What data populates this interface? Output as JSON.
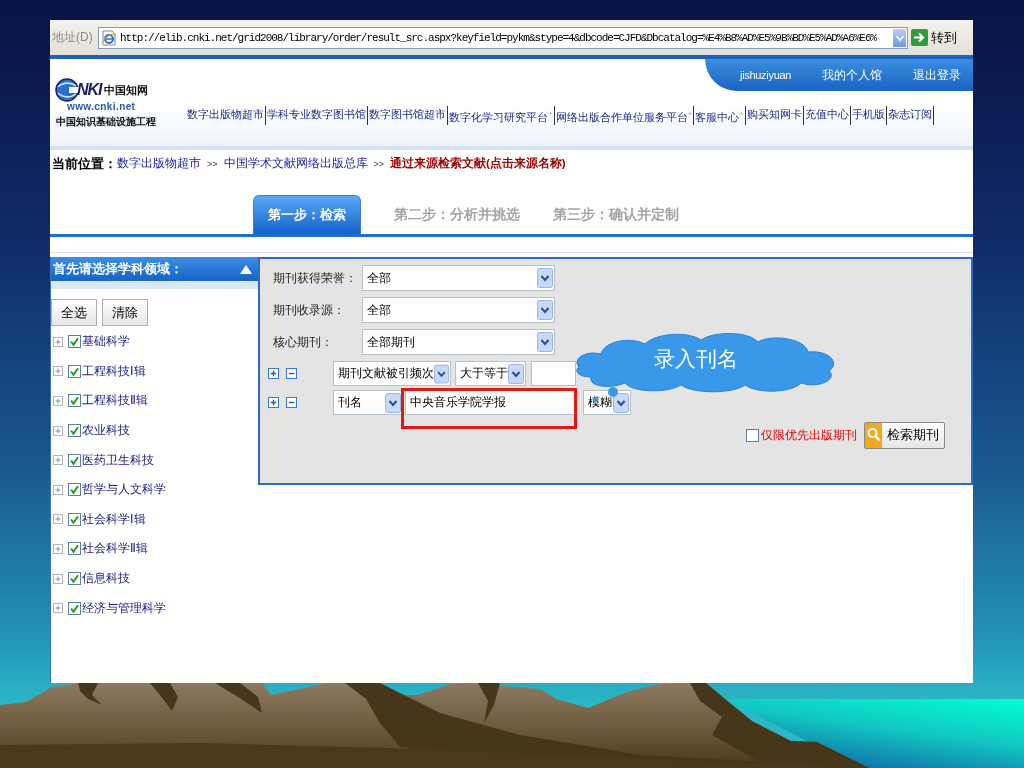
{
  "address_bar": {
    "label": "地址(D)",
    "url": "http://elib.cnki.net/grid2008/library/order/result_src.aspx?keyfield=pykm&stype=4&dbcode=CJFD&Dbcatalog=%E4%B8%AD%E5%9B%BD%E5%AD%A6%E6%",
    "go_label": "转到"
  },
  "logo": {
    "mark": "NKI",
    "name": "中国知网",
    "url": "www.cnki.net",
    "tagline": "中国知识基础设施工程"
  },
  "user_links": [
    "jishuziyuan",
    "我的个人馆",
    "退出登录"
  ],
  "nav": [
    "数字出版物超市",
    "学科专业数字图书馆",
    "数字图书馆超市",
    "数字化学习研究平台$^{+}$",
    "网络出版合作单位服务平台$^{+}$",
    "客服中心$^{+}$",
    "购买知网卡",
    "充值中心",
    "手机版",
    "杂志订阅"
  ],
  "breadcrumb": {
    "label": "当前位置：",
    "parts": [
      {
        "kind": "link",
        "text": "数字出版物超市"
      },
      {
        "kind": "separator",
        "text": ">>"
      },
      {
        "kind": "link",
        "text": "中国学术文献网络出版总库"
      },
      {
        "kind": "separator",
        "text": ">>"
      },
      {
        "kind": "current",
        "text": "通过来源检索文献(点击来源名称)"
      }
    ]
  },
  "steps": [
    {
      "label": "第一步：检索",
      "selected": true
    },
    {
      "label": "第二步：分析并挑选",
      "selected": false
    },
    {
      "label": "第三步：确认并定制",
      "selected": false
    }
  ],
  "subject_panel": {
    "title": "首先请选择学科领域：",
    "buttons": [
      "全选",
      "清除"
    ],
    "subjects": [
      {
        "label": "基础科学",
        "checked": true,
        "expanded": false
      },
      {
        "label": "工程科技Ⅰ辑",
        "checked": true,
        "expanded": false
      },
      {
        "label": "工程科技Ⅱ辑",
        "checked": true,
        "expanded": false
      },
      {
        "label": "农业科技",
        "checked": true,
        "expanded": false
      },
      {
        "label": "医药卫生科技",
        "checked": true,
        "expanded": false
      },
      {
        "label": "哲学与人文科学",
        "checked": true,
        "expanded": false
      },
      {
        "label": "社会科学Ⅰ辑",
        "checked": true,
        "expanded": false
      },
      {
        "label": "社会科学Ⅱ辑",
        "checked": true,
        "expanded": false
      },
      {
        "label": "信息科技",
        "checked": true,
        "expanded": false
      },
      {
        "label": "经济与管理科学",
        "checked": true,
        "expanded": false
      }
    ]
  },
  "search_form": {
    "filters": [
      {
        "label": "期刊获得荣誉：",
        "value": "全部"
      },
      {
        "label": "期刊收录源：",
        "value": "全部"
      },
      {
        "label": "核心期刊：",
        "value": "全部期刊"
      }
    ],
    "conditions": [
      {
        "field": "期刊文献被引频次",
        "operator": "大于等于",
        "highlighted": false
      },
      {
        "field": "刊名",
        "value": "中央音乐学院学报",
        "match": "模糊",
        "highlighted": true
      }
    ],
    "callout": {
      "text": "录入刊名"
    },
    "priority_filter": {
      "label": "仅限优先出版期刊",
      "checked": false
    },
    "search_button": "检索期刊"
  }
}
